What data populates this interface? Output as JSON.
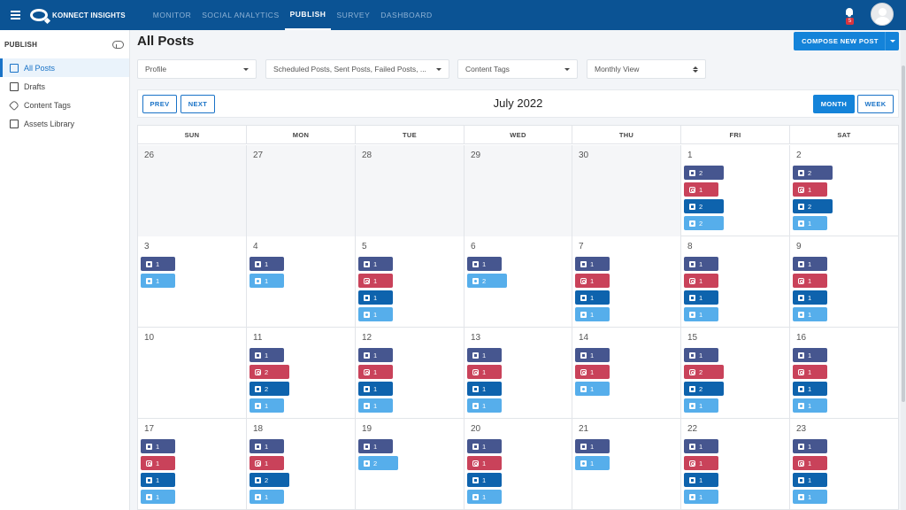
{
  "topbar": {
    "brand": "KONNECT INSIGHTS",
    "nav": [
      "MONITOR",
      "SOCIAL ANALYTICS",
      "PUBLISH",
      "SURVEY",
      "DASHBOARD"
    ],
    "active_nav": "PUBLISH",
    "notification_count": "5",
    "icons": {
      "menu": "hamburger-icon",
      "bell": "bell-icon",
      "avatar": "user-avatar"
    }
  },
  "sidebar": {
    "header": "PUBLISH",
    "header_icon": "cloud-upload-icon",
    "items": [
      {
        "label": "All Posts",
        "icon": "calendar-icon",
        "active": true
      },
      {
        "label": "Drafts",
        "icon": "document-icon",
        "active": false
      },
      {
        "label": "Content Tags",
        "icon": "tag-icon",
        "active": false
      },
      {
        "label": "Assets Library",
        "icon": "image-icon",
        "active": false
      }
    ]
  },
  "main": {
    "title": "All Posts",
    "compose_label": "COMPOSE NEW POST",
    "filters": {
      "profile": "Profile",
      "post_status": "Scheduled Posts, Sent Posts, Failed Posts, ...",
      "content_tags": "Content Tags",
      "view": "Monthly View"
    },
    "toolbar": {
      "prev": "PREV",
      "next": "NEXT",
      "month": "MONTH",
      "week": "WEEK",
      "title": "July 2022"
    }
  },
  "calendar": {
    "days_of_week": [
      "SUN",
      "MON",
      "TUE",
      "WED",
      "THU",
      "FRI",
      "SAT"
    ],
    "weeks": [
      [
        {
          "n": "26",
          "other": true,
          "posts": []
        },
        {
          "n": "27",
          "other": true,
          "posts": []
        },
        {
          "n": "28",
          "other": true,
          "posts": []
        },
        {
          "n": "29",
          "other": true,
          "posts": []
        },
        {
          "n": "30",
          "other": true,
          "posts": []
        },
        {
          "n": "1",
          "posts": [
            [
              "fb",
              "2"
            ],
            [
              "ig",
              "1"
            ],
            [
              "li",
              "2"
            ],
            [
              "tw",
              "2"
            ]
          ]
        },
        {
          "n": "2",
          "posts": [
            [
              "fb",
              "2"
            ],
            [
              "ig",
              "1"
            ],
            [
              "li",
              "2"
            ],
            [
              "tw",
              "1"
            ]
          ]
        }
      ],
      [
        {
          "n": "3",
          "posts": [
            [
              "fb",
              "1"
            ],
            [
              "tw",
              "1"
            ]
          ]
        },
        {
          "n": "4",
          "posts": [
            [
              "fb",
              "1"
            ],
            [
              "tw",
              "1"
            ]
          ]
        },
        {
          "n": "5",
          "posts": [
            [
              "fb",
              "1"
            ],
            [
              "ig",
              "1"
            ],
            [
              "li",
              "1"
            ],
            [
              "tw",
              "1"
            ]
          ]
        },
        {
          "n": "6",
          "posts": [
            [
              "fb",
              "1"
            ],
            [
              "tw",
              "2"
            ]
          ]
        },
        {
          "n": "7",
          "posts": [
            [
              "fb",
              "1"
            ],
            [
              "ig",
              "1"
            ],
            [
              "li",
              "1"
            ],
            [
              "tw",
              "1"
            ]
          ]
        },
        {
          "n": "8",
          "posts": [
            [
              "fb",
              "1"
            ],
            [
              "ig",
              "1"
            ],
            [
              "li",
              "1"
            ],
            [
              "tw",
              "1"
            ]
          ]
        },
        {
          "n": "9",
          "posts": [
            [
              "fb",
              "1"
            ],
            [
              "ig",
              "1"
            ],
            [
              "li",
              "1"
            ],
            [
              "tw",
              "1"
            ]
          ]
        }
      ],
      [
        {
          "n": "10",
          "posts": []
        },
        {
          "n": "11",
          "posts": [
            [
              "fb",
              "1"
            ],
            [
              "ig",
              "2"
            ],
            [
              "li",
              "2"
            ],
            [
              "tw",
              "1"
            ]
          ]
        },
        {
          "n": "12",
          "posts": [
            [
              "fb",
              "1"
            ],
            [
              "ig",
              "1"
            ],
            [
              "li",
              "1"
            ],
            [
              "tw",
              "1"
            ]
          ]
        },
        {
          "n": "13",
          "posts": [
            [
              "fb",
              "1"
            ],
            [
              "ig",
              "1"
            ],
            [
              "li",
              "1"
            ],
            [
              "tw",
              "1"
            ]
          ]
        },
        {
          "n": "14",
          "posts": [
            [
              "fb",
              "1"
            ],
            [
              "ig",
              "1"
            ],
            [
              "tw",
              "1"
            ]
          ]
        },
        {
          "n": "15",
          "posts": [
            [
              "fb",
              "1"
            ],
            [
              "ig",
              "2"
            ],
            [
              "li",
              "2"
            ],
            [
              "tw",
              "1"
            ]
          ]
        },
        {
          "n": "16",
          "posts": [
            [
              "fb",
              "1"
            ],
            [
              "ig",
              "1"
            ],
            [
              "li",
              "1"
            ],
            [
              "tw",
              "1"
            ]
          ]
        }
      ],
      [
        {
          "n": "17",
          "posts": [
            [
              "fb",
              "1"
            ],
            [
              "ig",
              "1"
            ],
            [
              "li",
              "1"
            ],
            [
              "tw",
              "1"
            ]
          ]
        },
        {
          "n": "18",
          "posts": [
            [
              "fb",
              "1"
            ],
            [
              "ig",
              "1"
            ],
            [
              "li",
              "2"
            ],
            [
              "tw",
              "1"
            ]
          ]
        },
        {
          "n": "19",
          "posts": [
            [
              "fb",
              "1"
            ],
            [
              "tw",
              "2"
            ]
          ]
        },
        {
          "n": "20",
          "posts": [
            [
              "fb",
              "1"
            ],
            [
              "ig",
              "1"
            ],
            [
              "li",
              "1"
            ],
            [
              "tw",
              "1"
            ]
          ]
        },
        {
          "n": "21",
          "posts": [
            [
              "fb",
              "1"
            ],
            [
              "tw",
              "1"
            ]
          ]
        },
        {
          "n": "22",
          "posts": [
            [
              "fb",
              "1"
            ],
            [
              "ig",
              "1"
            ],
            [
              "li",
              "1"
            ],
            [
              "tw",
              "1"
            ]
          ]
        },
        {
          "n": "23",
          "posts": [
            [
              "fb",
              "1"
            ],
            [
              "ig",
              "1"
            ],
            [
              "li",
              "1"
            ],
            [
              "tw",
              "1"
            ]
          ]
        }
      ]
    ]
  },
  "network_colors": {
    "fb": "#46568f",
    "ig": "#c9425a",
    "li": "#0e63ad",
    "tw": "#56aeeb"
  },
  "network_icons": {
    "fb": "facebook-icon",
    "ig": "instagram-icon",
    "li": "linkedin-icon",
    "tw": "twitter-icon"
  }
}
